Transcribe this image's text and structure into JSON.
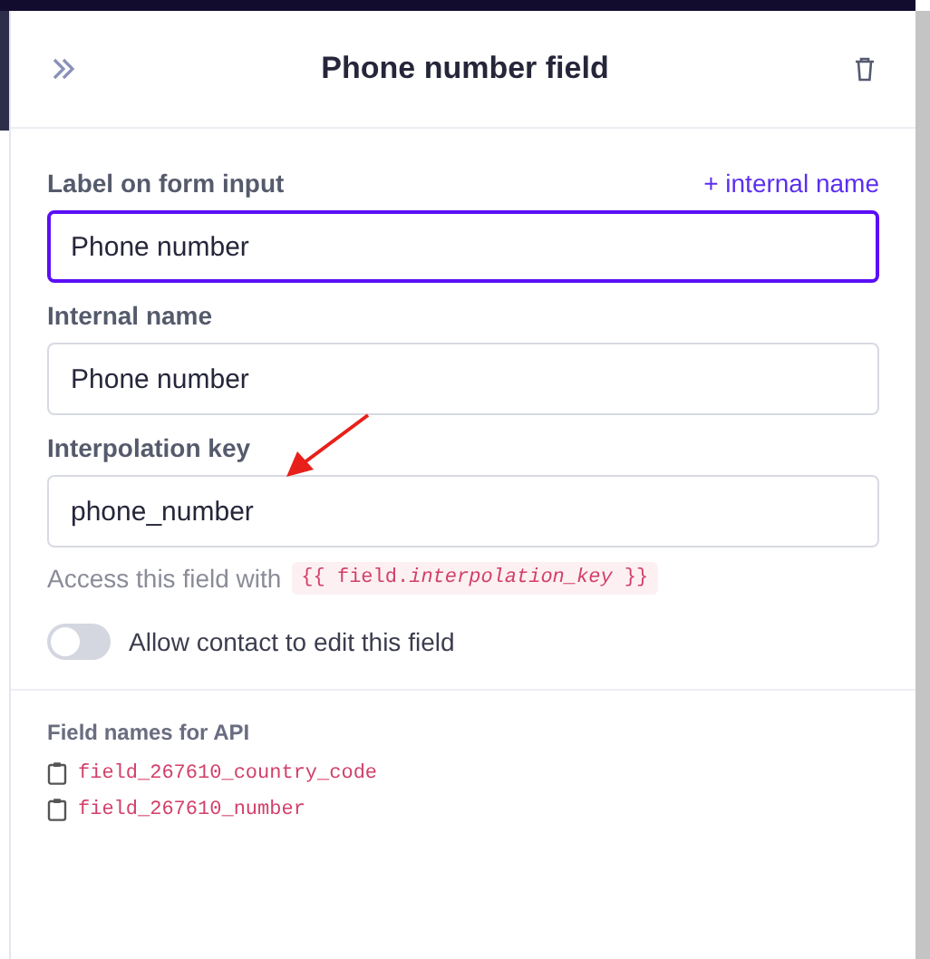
{
  "panel": {
    "title": "Phone number field"
  },
  "fields": [
    {
      "label": "Label on form input",
      "value": "Phone number",
      "focused": true,
      "action": "+ internal name"
    },
    {
      "label": "Internal name",
      "value": "Phone number",
      "focused": false
    },
    {
      "label": "Interpolation key",
      "value": "phone_number",
      "focused": false
    }
  ],
  "help": {
    "text": "Access this field with",
    "code": "{{ field.*interpolation_key* }}"
  },
  "toggle": {
    "label": "Allow contact to edit this field",
    "on": false
  },
  "api": {
    "title": "Field names for API",
    "names": [
      "field_267610_country_code",
      "field_267610_number"
    ]
  }
}
